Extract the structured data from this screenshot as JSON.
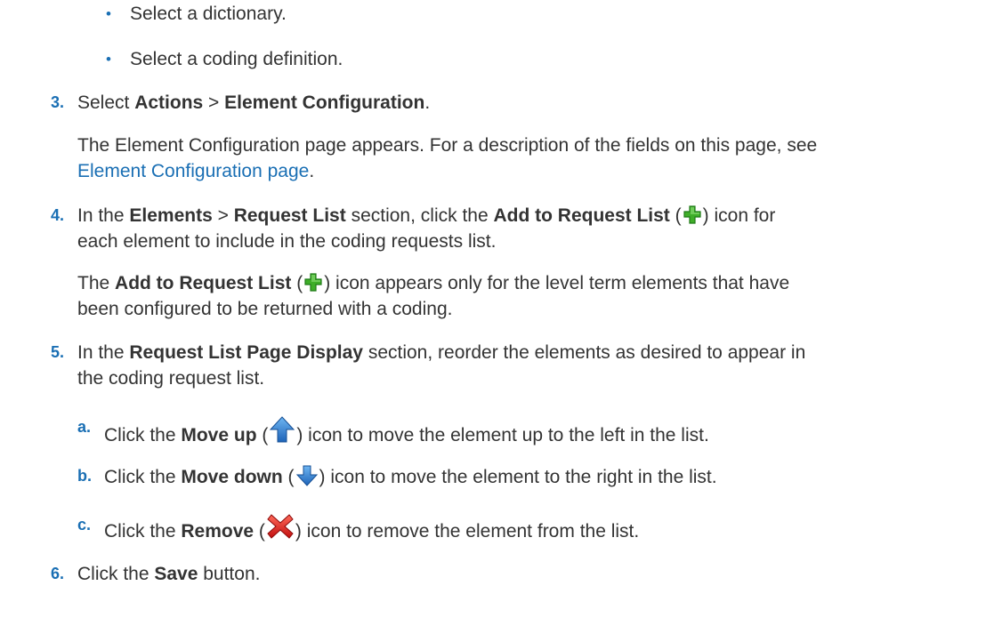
{
  "bullets": [
    {
      "text": "Select a dictionary."
    },
    {
      "text": "Select a coding definition."
    }
  ],
  "step3": {
    "number": "3.",
    "pre": "Select ",
    "actions": "Actions",
    "sep": " > ",
    "element_configuration": "Element Configuration",
    "post": ".",
    "desc_line1": "The Element Configuration page appears. For a description of the fields on this page, see",
    "link_text": "Element Configuration page",
    "link_post": "."
  },
  "step4": {
    "number": "4.",
    "pre": "In the ",
    "elements": "Elements",
    "sep": " > ",
    "request_list": "Request List",
    "mid": " section, click the ",
    "add_to_request_list": "Add to Request List",
    "open": " (",
    "close": ") icon for",
    "line2": "each element to include in the coding requests list.",
    "note_pre": "The ",
    "note_bold": "Add to Request List",
    "note_open": " (",
    "note_close": ") icon appears only for the level term elements that have",
    "note_line2": "been configured to be returned with a coding."
  },
  "step5": {
    "number": "5.",
    "pre": "In the ",
    "bold": "Request List Page Display",
    "post": " section, reorder the elements as desired to appear in",
    "line2": "the coding request list.",
    "substeps": [
      {
        "letter": "a.",
        "pre": "Click the ",
        "bold": "Move up",
        "open": " (",
        "close": ") icon to move the element up to the left in the list.",
        "icon": "arrow-up-icon"
      },
      {
        "letter": "b.",
        "pre": "Click the ",
        "bold": "Move down",
        "open": " (",
        "close": ") icon to move the element to the right in the list.",
        "icon": "arrow-down-icon"
      },
      {
        "letter": "c.",
        "pre": "Click the ",
        "bold": "Remove",
        "open": " (",
        "close": ") icon to remove the element from the list.",
        "icon": "red-x-icon"
      }
    ]
  },
  "step6": {
    "number": "6.",
    "pre": "Click the ",
    "bold": "Save",
    "post": " button."
  },
  "colors": {
    "accent": "#1a6fb4",
    "text": "#333333",
    "plus_icon": "#3fae29",
    "remove_icon": "#d11a1a",
    "arrow_icon": "#2a7ed3"
  },
  "icons": [
    "plus-icon",
    "arrow-up-icon",
    "arrow-down-icon",
    "red-x-icon"
  ]
}
